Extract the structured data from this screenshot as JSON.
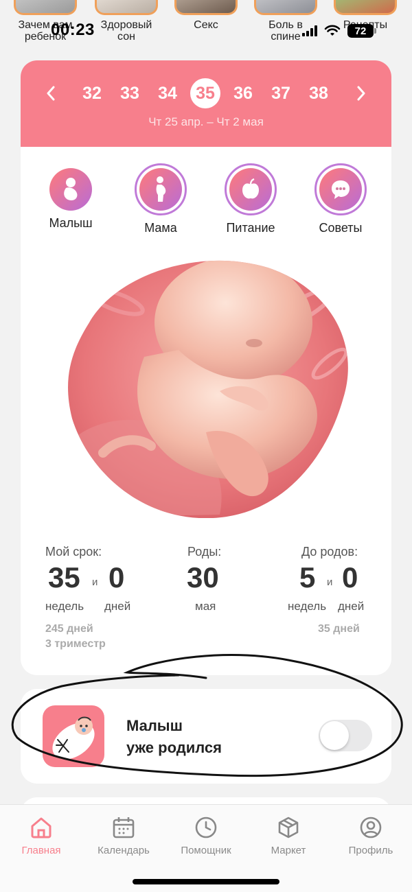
{
  "stories": [
    {
      "label": "Зачем вам ребенок"
    },
    {
      "label": "Здоровый сон"
    },
    {
      "label": "Секс"
    },
    {
      "label": "Боль в спине"
    },
    {
      "label": "Рецепты"
    }
  ],
  "status_bar": {
    "time": "00:23",
    "battery": "72"
  },
  "week_selector": {
    "weeks": [
      "32",
      "33",
      "34",
      "35",
      "36",
      "37",
      "38"
    ],
    "active_week": "35",
    "date_range": "Чт 25 апр. – Чт 2 мая"
  },
  "categories": [
    {
      "label": "Малыш",
      "icon": "baby-icon"
    },
    {
      "label": "Мама",
      "icon": "pregnant-icon"
    },
    {
      "label": "Питание",
      "icon": "apple-icon"
    },
    {
      "label": "Советы",
      "icon": "chat-icon"
    }
  ],
  "stats": {
    "term": {
      "title": "Мой срок:",
      "weeks": "35",
      "and": "и",
      "days": "0",
      "weeks_unit": "недель",
      "days_unit": "дней",
      "total_days": "245 дней",
      "trimester": "3 триместр"
    },
    "birth": {
      "title": "Роды:",
      "day": "30",
      "month": "мая"
    },
    "until": {
      "title": "До родов:",
      "weeks": "5",
      "and": "и",
      "days": "0",
      "weeks_unit": "недель",
      "days_unit": "дней",
      "total_days": "35 дней"
    }
  },
  "born_card": {
    "line1": "Малыш",
    "line2": "уже родился",
    "toggle_on": false
  },
  "nav": [
    {
      "label": "Главная",
      "icon": "home-icon",
      "active": true
    },
    {
      "label": "Календарь",
      "icon": "calendar-icon",
      "active": false
    },
    {
      "label": "Помощник",
      "icon": "clock-icon",
      "active": false
    },
    {
      "label": "Маркет",
      "icon": "box-icon",
      "active": false
    },
    {
      "label": "Профиль",
      "icon": "profile-icon",
      "active": false
    }
  ],
  "colors": {
    "accent": "#f77f8c",
    "gradient_start": "#ff7a7a",
    "gradient_end": "#b86cd6"
  }
}
